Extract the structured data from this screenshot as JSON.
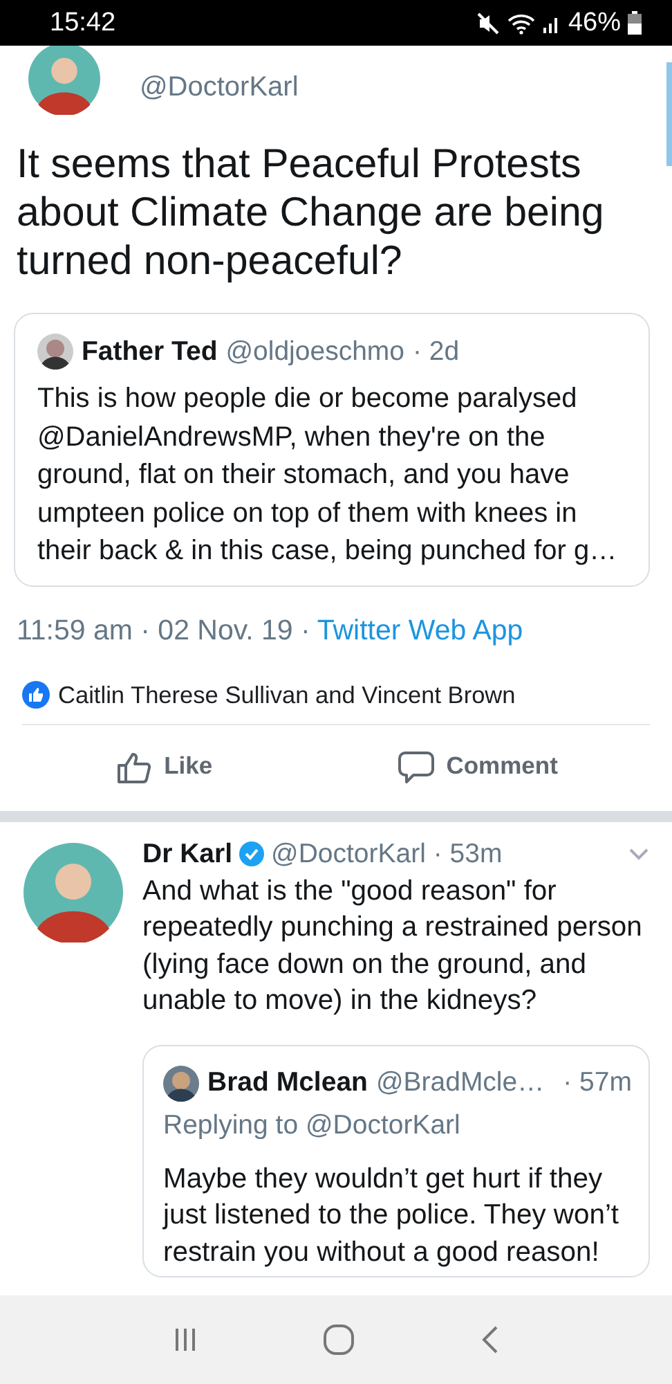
{
  "status_bar": {
    "time": "15:42",
    "battery": "46%"
  },
  "tweet": {
    "handle": "@DoctorKarl",
    "text": "It seems that Peaceful Protests about Climate Change are being turned non-peaceful?",
    "quoted": {
      "name": "Father Ted",
      "handle": "@oldjoeschmo",
      "age": "· 2d",
      "text": "This is how people die or become paralysed @DanielAndrewsMP, when they're on the ground, flat on their stomach, and you have umpteen police on top of them with knees in their back & in this case, being punched for g…"
    },
    "timestamp": "11:59 am · 02 Nov. 19 ·",
    "source": "Twitter Web App"
  },
  "reactions": {
    "text": "Caitlin Therese Sullivan and Vincent Brown"
  },
  "actions": [
    {
      "kind": "like",
      "label": "Like"
    },
    {
      "kind": "comment",
      "label": "Comment"
    }
  ],
  "reply": {
    "name": "Dr Karl",
    "verified": true,
    "handle": "@DoctorKarl · 53m",
    "text": "And what is the \"good reason\" for repeatedly punching a restrained person (lying face down on the ground, and unable to move) in the kidneys?",
    "quoted": {
      "name": "Brad Mclean",
      "handle": "@BradMcle…",
      "age": "· 57m",
      "replying_to": "Replying to @DoctorKarl",
      "text": "Maybe they wouldn’t get hurt if they just listened to the police. They won’t restrain you without a good reason!"
    }
  }
}
